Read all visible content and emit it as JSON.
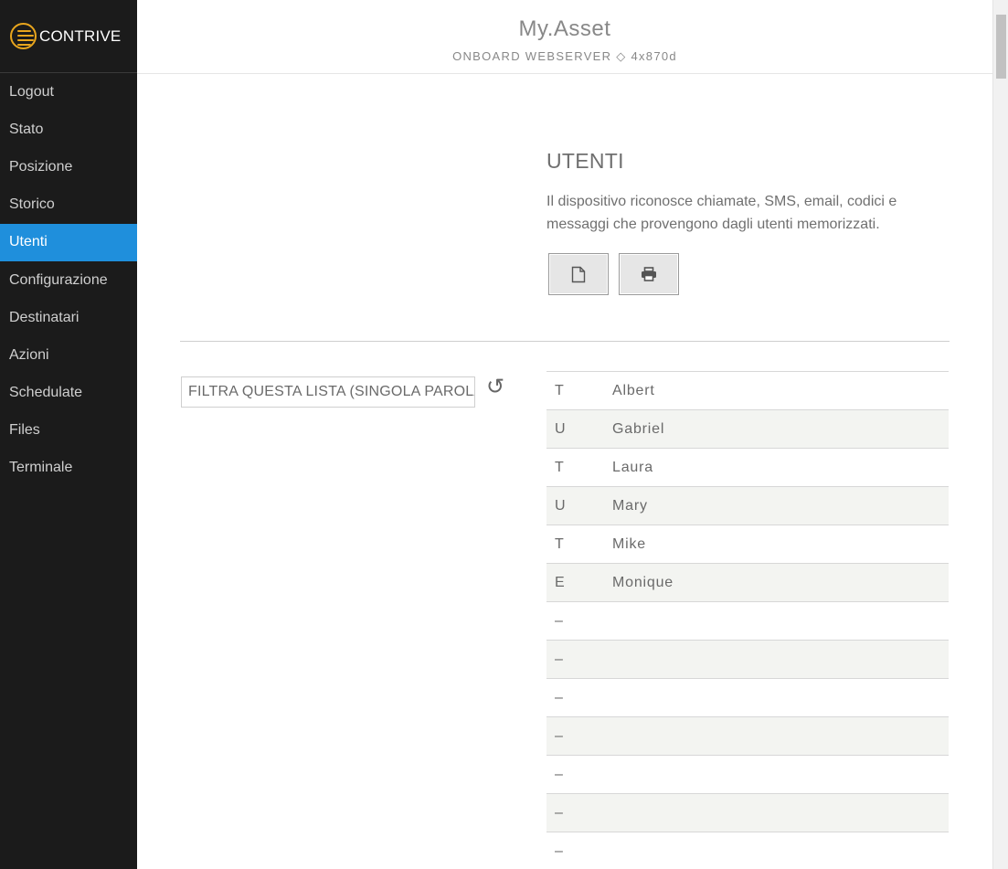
{
  "brand": {
    "logo_text": "CONTRIVE",
    "accent": "#e8a51d"
  },
  "sidebar": {
    "active_color": "#1f8fdc",
    "items": [
      {
        "label": "Logout"
      },
      {
        "label": "Stato"
      },
      {
        "label": "Posizione"
      },
      {
        "label": "Storico"
      },
      {
        "label": "Utenti",
        "active": true
      },
      {
        "label": "Configurazione"
      },
      {
        "label": "Destinatari"
      },
      {
        "label": "Azioni"
      },
      {
        "label": "Schedulate"
      },
      {
        "label": "Files"
      },
      {
        "label": "Terminale"
      }
    ]
  },
  "header": {
    "title": "My.Asset",
    "subtitle": "ONBOARD WEBSERVER ◇ 4x870d"
  },
  "section": {
    "title": "UTENTI",
    "description": "Il dispositivo riconosce chiamate, SMS, email, codici e messaggi che provengono dagli utenti memorizzati.",
    "buttons": [
      {
        "icon": "new-document-icon"
      },
      {
        "icon": "printer-icon"
      }
    ]
  },
  "filter": {
    "placeholder": "FILTRA QUESTA LISTA (SINGOLA PAROLA)",
    "reset_icon": "↺"
  },
  "users": [
    {
      "type": "T",
      "name": "Albert"
    },
    {
      "type": "U",
      "name": "Gabriel"
    },
    {
      "type": "T",
      "name": "Laura"
    },
    {
      "type": "U",
      "name": "Mary"
    },
    {
      "type": "T",
      "name": "Mike"
    },
    {
      "type": "E",
      "name": "Monique"
    },
    {
      "type": "–",
      "name": ""
    },
    {
      "type": "–",
      "name": ""
    },
    {
      "type": "–",
      "name": ""
    },
    {
      "type": "–",
      "name": ""
    },
    {
      "type": "–",
      "name": ""
    },
    {
      "type": "–",
      "name": ""
    },
    {
      "type": "–",
      "name": ""
    }
  ]
}
